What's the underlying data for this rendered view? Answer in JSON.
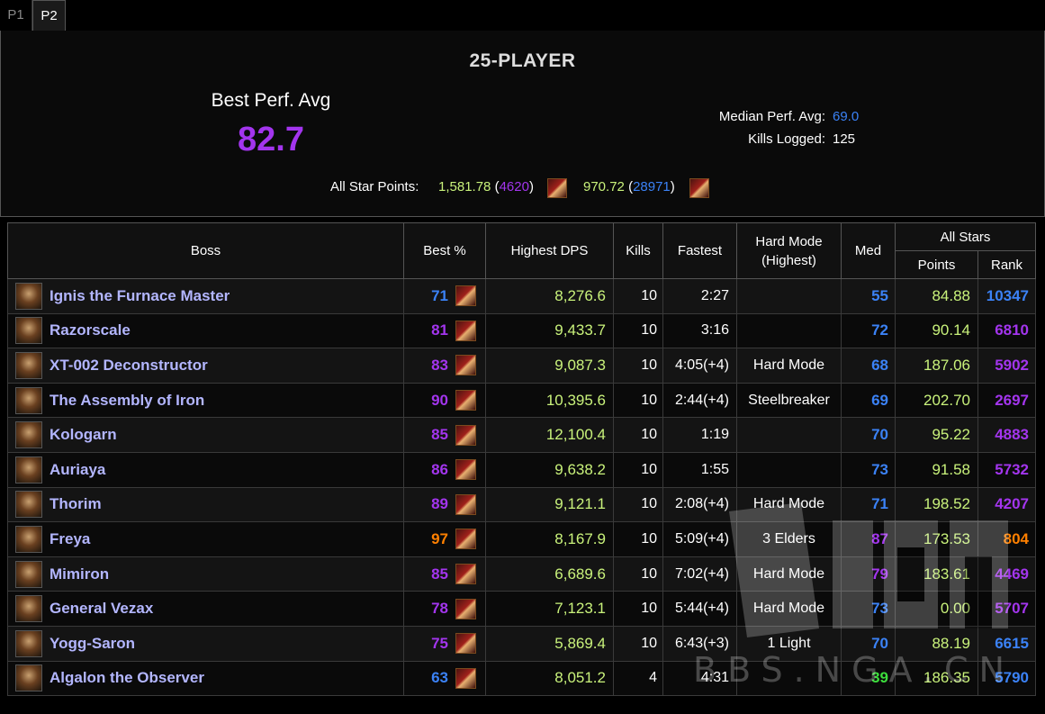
{
  "tabs": [
    {
      "label": "P1",
      "active": false
    },
    {
      "label": "P2",
      "active": true
    }
  ],
  "summary": {
    "mode_title": "25-PLAYER",
    "best_perf_label": "Best Perf. Avg",
    "best_perf_value": "82.7",
    "median_label": "Median Perf. Avg:",
    "median_value": "69.0",
    "kills_label": "Kills Logged:",
    "kills_value": "125",
    "star_points_label": "All Star Points:",
    "star1_points": "1,581.78",
    "star1_rank": "4620",
    "star1_icon": "spec-icon",
    "star2_points": "970.72",
    "star2_rank": "28971",
    "star2_icon": "spec-icon"
  },
  "table": {
    "headers": {
      "boss": "Boss",
      "best": "Best %",
      "dps": "Highest DPS",
      "kills": "Kills",
      "fastest": "Fastest",
      "hardmode_line1": "Hard Mode",
      "hardmode_line2": "(Highest)",
      "med": "Med",
      "allstars": "All Stars",
      "points": "Points",
      "rank": "Rank"
    },
    "rows": [
      {
        "boss": "Ignis the Furnace Master",
        "best": "71",
        "best_color": "blue",
        "dps": "8,276.6",
        "kills": "10",
        "fastest": "2:27",
        "hardmode": "",
        "med": "55",
        "med_color": "blue",
        "points": "84.88",
        "rank": "10347",
        "rank_color": "blue"
      },
      {
        "boss": "Razorscale",
        "best": "81",
        "best_color": "purple",
        "dps": "9,433.7",
        "kills": "10",
        "fastest": "3:16",
        "hardmode": "",
        "med": "72",
        "med_color": "blue",
        "points": "90.14",
        "rank": "6810",
        "rank_color": "purple"
      },
      {
        "boss": "XT-002 Deconstructor",
        "best": "83",
        "best_color": "purple",
        "dps": "9,087.3",
        "kills": "10",
        "fastest": "4:05(+4)",
        "hardmode": "Hard Mode",
        "med": "68",
        "med_color": "blue",
        "points": "187.06",
        "rank": "5902",
        "rank_color": "purple"
      },
      {
        "boss": "The Assembly of Iron",
        "best": "90",
        "best_color": "purple",
        "dps": "10,395.6",
        "kills": "10",
        "fastest": "2:44(+4)",
        "hardmode": "Steelbreaker",
        "med": "69",
        "med_color": "blue",
        "points": "202.70",
        "rank": "2697",
        "rank_color": "purple"
      },
      {
        "boss": "Kologarn",
        "best": "85",
        "best_color": "purple",
        "dps": "12,100.4",
        "kills": "10",
        "fastest": "1:19",
        "hardmode": "",
        "med": "70",
        "med_color": "blue",
        "points": "95.22",
        "rank": "4883",
        "rank_color": "purple"
      },
      {
        "boss": "Auriaya",
        "best": "86",
        "best_color": "purple",
        "dps": "9,638.2",
        "kills": "10",
        "fastest": "1:55",
        "hardmode": "",
        "med": "73",
        "med_color": "blue",
        "points": "91.58",
        "rank": "5732",
        "rank_color": "purple"
      },
      {
        "boss": "Thorim",
        "best": "89",
        "best_color": "purple",
        "dps": "9,121.1",
        "kills": "10",
        "fastest": "2:08(+4)",
        "hardmode": "Hard Mode",
        "med": "71",
        "med_color": "blue",
        "points": "198.52",
        "rank": "4207",
        "rank_color": "purple"
      },
      {
        "boss": "Freya",
        "best": "97",
        "best_color": "orange",
        "dps": "8,167.9",
        "kills": "10",
        "fastest": "5:09(+4)",
        "hardmode": "3 Elders",
        "med": "87",
        "med_color": "purple",
        "points": "173.53",
        "rank": "804",
        "rank_color": "orange"
      },
      {
        "boss": "Mimiron",
        "best": "85",
        "best_color": "purple",
        "dps": "6,689.6",
        "kills": "10",
        "fastest": "7:02(+4)",
        "hardmode": "Hard Mode",
        "med": "79",
        "med_color": "purple",
        "points": "183.61",
        "rank": "4469",
        "rank_color": "purple"
      },
      {
        "boss": "General Vezax",
        "best": "78",
        "best_color": "purple",
        "dps": "7,123.1",
        "kills": "10",
        "fastest": "5:44(+4)",
        "hardmode": "Hard Mode",
        "med": "73",
        "med_color": "blue",
        "points": "0.00",
        "rank": "5707",
        "rank_color": "purple"
      },
      {
        "boss": "Yogg-Saron",
        "best": "75",
        "best_color": "purple",
        "dps": "5,869.4",
        "kills": "10",
        "fastest": "6:43(+3)",
        "hardmode": "1 Light",
        "med": "70",
        "med_color": "blue",
        "points": "88.19",
        "rank": "6615",
        "rank_color": "blue"
      },
      {
        "boss": "Algalon the Observer",
        "best": "63",
        "best_color": "blue",
        "dps": "8,051.2",
        "kills": "4",
        "fastest": "4:31",
        "hardmode": "",
        "med": "39",
        "med_color": "green",
        "points": "186.35",
        "rank": "5790",
        "rank_color": "blue"
      }
    ]
  },
  "watermark": {
    "logo": "NGA",
    "text": "BBS.NGA.CN"
  },
  "colors": {
    "purple": "#a335ee",
    "blue": "#3b82f6",
    "orange": "#ff8000",
    "green": "#3cde3c",
    "dps_green": "#c9f27b",
    "boss_name": "#b3b6ff"
  }
}
